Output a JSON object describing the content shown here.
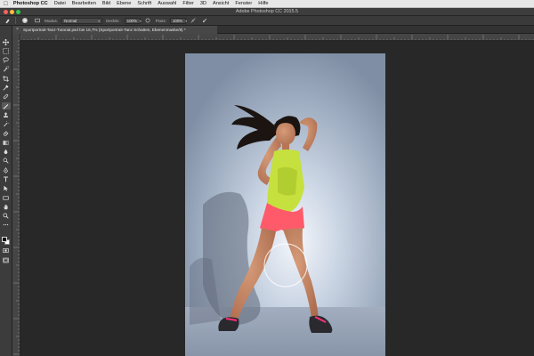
{
  "menubar": {
    "app_name": "Photoshop CC",
    "items": [
      "Datei",
      "Bearbeiten",
      "Bild",
      "Ebene",
      "Schrift",
      "Auswahl",
      "Filter",
      "3D",
      "Ansicht",
      "Fenster",
      "Hilfe"
    ]
  },
  "window": {
    "title": "Adobe Photoshop CC 2015.5"
  },
  "options": {
    "mode_label": "Modus:",
    "mode_value": "Normal",
    "opacity_label": "Deckkr.:",
    "opacity_value": "100%",
    "flow_label": "Fluss:",
    "flow_value": "100%"
  },
  "document": {
    "tab_title": "Sportportrait-Tanz-Tutorial.psd bei 16,7% (Sportportrait-Tanz Schatten, Ebenenmaske/8) *",
    "close_glyph": "×"
  },
  "toolbar": {
    "active_tool": "brush-tool"
  },
  "colors": {
    "accent_red": "#fc605b",
    "accent_yellow": "#fdbc40",
    "accent_green": "#34c84a",
    "workspace": "#282828",
    "foreground": "#000000",
    "background": "#ffffff"
  }
}
